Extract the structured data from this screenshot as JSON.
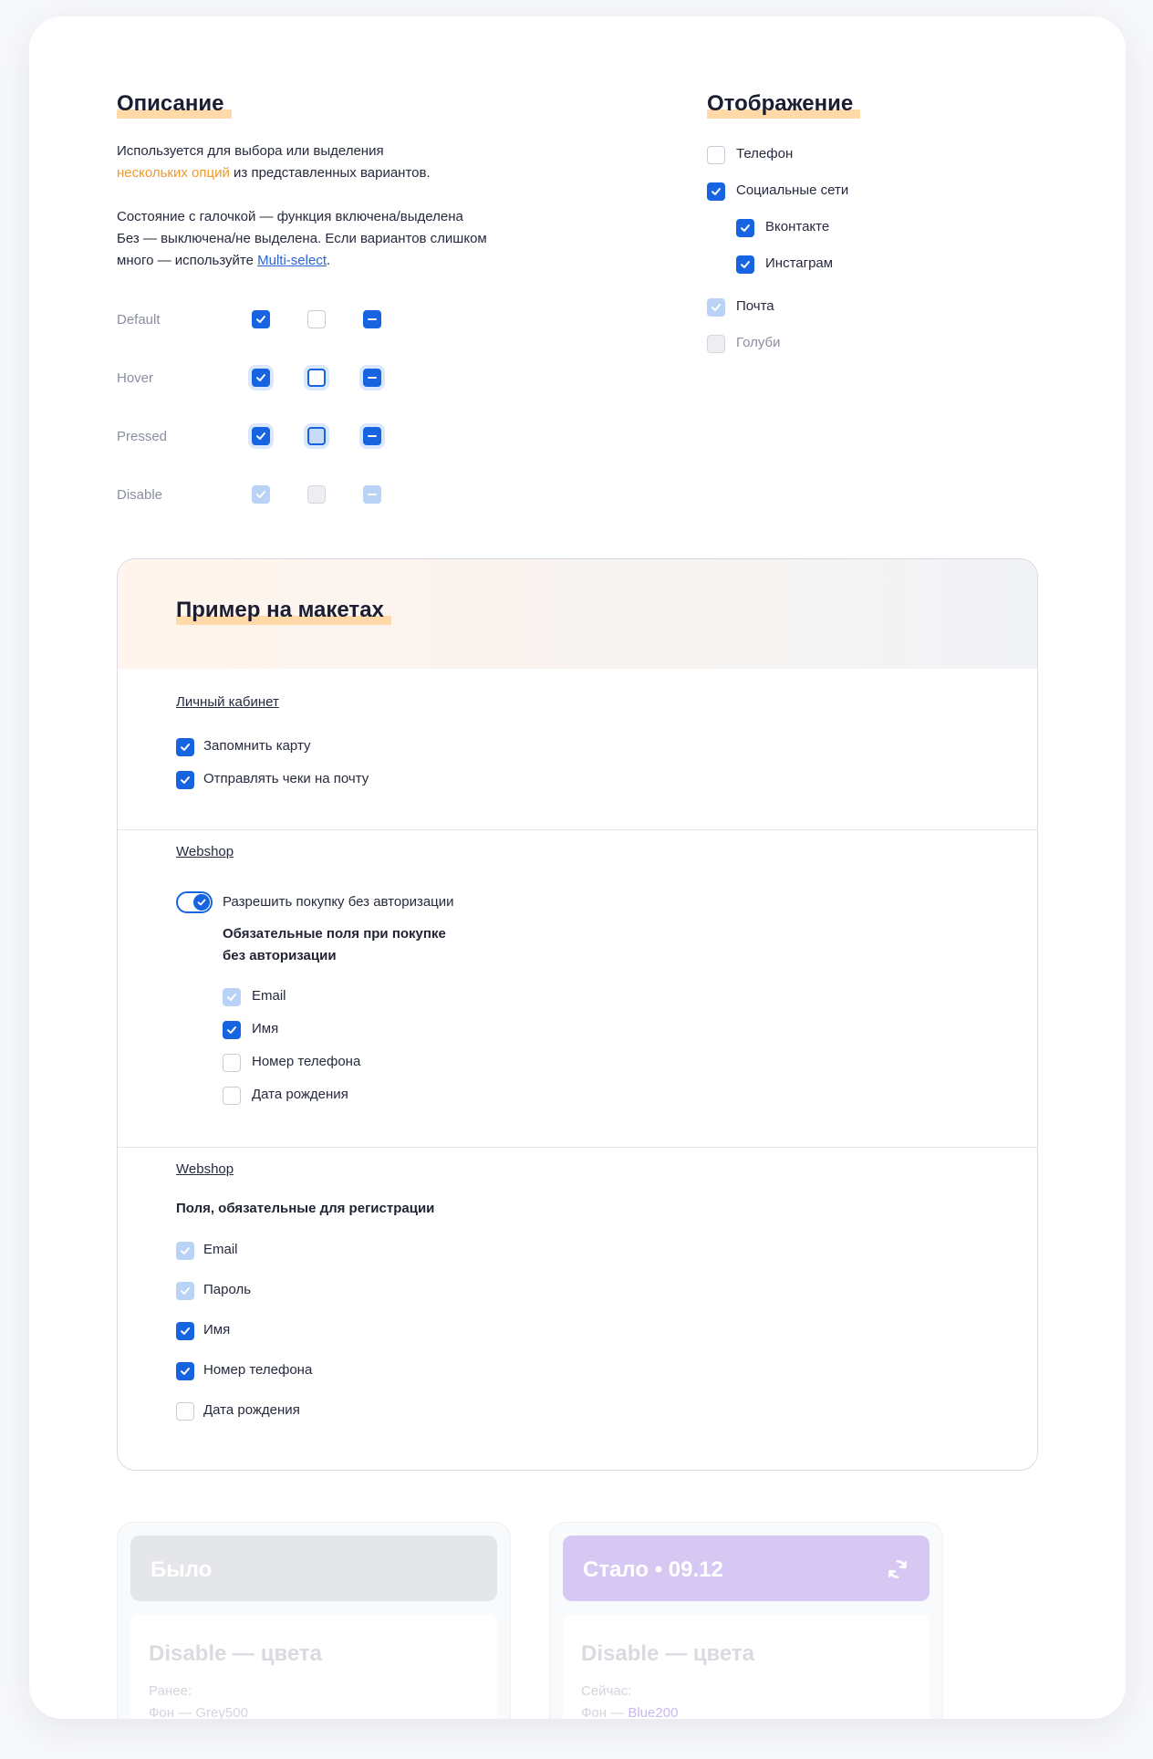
{
  "description": {
    "title": "Описание",
    "line1": "Используется для выбора или выделения",
    "line2_accent": "нескольких опций",
    "line2_rest": " из представленных вариантов.",
    "line3": "Состояние с галочкой — функция включена/выделена",
    "line4": "Без — выключена/не выделена. Если вариантов слишком",
    "line5_start": "много — используйте ",
    "line5_link": "Multi-select",
    "line5_end": "."
  },
  "states": [
    {
      "label": "Default"
    },
    {
      "label": "Hover"
    },
    {
      "label": "Pressed"
    },
    {
      "label": "Disable"
    }
  ],
  "display": {
    "title": "Отображение",
    "items": [
      {
        "label": "Телефон",
        "checked": false,
        "disabled": false
      },
      {
        "label": "Социальные сети",
        "checked": true,
        "disabled": false
      },
      {
        "label": "Вконтакте",
        "checked": true,
        "disabled": false
      },
      {
        "label": "Инстаграм",
        "checked": true,
        "disabled": false
      },
      {
        "label": "Почта",
        "checked": true,
        "disabled": true
      },
      {
        "label": "Голуби",
        "checked": false,
        "disabled": true
      }
    ]
  },
  "examples": {
    "title": "Пример на макетах",
    "section1": {
      "link": "Личный кабинет",
      "items": [
        {
          "label": "Запомнить карту",
          "checked": true
        },
        {
          "label": "Отправлять чеки на почту",
          "checked": true
        }
      ]
    },
    "section2": {
      "link": "Webshop",
      "toggle_label": "Разрешить покупку без авторизации",
      "toggle_on": true,
      "heading_line1": "Обязательные поля при покупке",
      "heading_line2": "без авторизации",
      "items": [
        {
          "label": "Email",
          "checked": true,
          "disabled": true
        },
        {
          "label": "Имя",
          "checked": true,
          "disabled": false
        },
        {
          "label": "Номер телефона",
          "checked": false,
          "disabled": false
        },
        {
          "label": "Дата рождения",
          "checked": false,
          "disabled": false
        }
      ]
    },
    "section3": {
      "link": "Webshop",
      "heading": "Поля, обязательные для регистрации",
      "items": [
        {
          "label": "Email",
          "checked": true,
          "disabled": true
        },
        {
          "label": "Пароль",
          "checked": true,
          "disabled": true
        },
        {
          "label": "Имя",
          "checked": true,
          "disabled": false
        },
        {
          "label": "Номер телефона",
          "checked": true,
          "disabled": false
        },
        {
          "label": "Дата рождения",
          "checked": false,
          "disabled": false
        }
      ]
    }
  },
  "before": {
    "header": "Было",
    "subtitle": "Disable — цвета",
    "note1": "Ранее:",
    "note2_prefix": "Фон — ",
    "note2_value": "Grey500",
    "header_color": "#e4e6ea"
  },
  "after": {
    "header": "Стало • 09.12",
    "subtitle": "Disable — цвета",
    "note1": "Сейчас:",
    "note2_prefix": "Фон — ",
    "note2_value": "Blue200",
    "header_color": "#d7c8f3",
    "icon": "refresh-icon"
  },
  "colors": {
    "primary": "#1664e0",
    "disabled_fill": "#b8d3f6",
    "accent_orange": "#ef9a2c",
    "highlight": "#ffd9a8"
  }
}
